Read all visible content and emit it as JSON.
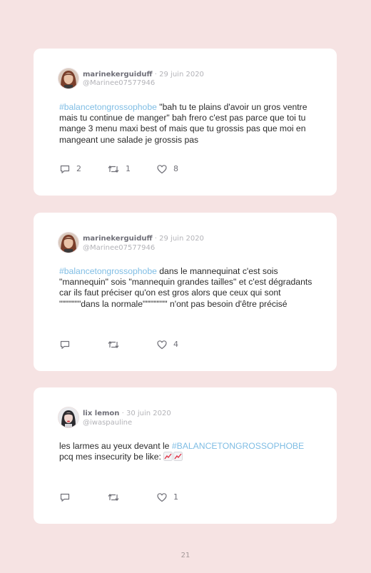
{
  "tweets": [
    {
      "display_name": "marinekerguiduff",
      "date": "· 29 juin 2020",
      "username": "@Marinee07577946",
      "hashtag": "#balancetongrossophobe",
      "text": " \"bah tu te plains d'avoir un gros ventre mais tu continue de manger\" bah frero c'est pas parce que toi tu mange 3 menu maxi best of mais que tu grossis pas que moi en mangeant une salade je grossis pas",
      "reply_count": "2",
      "retweet_count": "1",
      "like_count": "8"
    },
    {
      "display_name": "marinekerguiduff",
      "date": "· 29 juin 2020",
      "username": "@Marinee07577946",
      "hashtag": "#balancetongrossophobe",
      "text": " dans le mannequinat c'est sois \"mannequin\" sois \"mannequin grandes tailles\" et c'est dégradants car ils faut préciser qu'on est gros alors que ceux qui sont \"\"\"\"\"\"\"dans la normale\"\"\"\"\"\"\"\" n'ont pas besoin d'être précisé",
      "reply_count": "",
      "retweet_count": "",
      "like_count": "4"
    },
    {
      "display_name": "lix lemon",
      "date": "· 30 juin 2020",
      "username": "@iwaspauline",
      "text_before": "les larmes au yeux devant le ",
      "hashtag": "#BALANCETONGROSSOPHOBE",
      "text": " pcq mes insecurity be like: ",
      "emoji": "chart-increasing-emoji",
      "reply_count": "",
      "retweet_count": "",
      "like_count": "1"
    }
  ],
  "page_number": "21",
  "colors": {
    "background": "#f6e3e3",
    "card": "#ffffff",
    "hashtag": "#7fbde4",
    "name": "#6f6f78",
    "muted": "#b3b3b8"
  }
}
